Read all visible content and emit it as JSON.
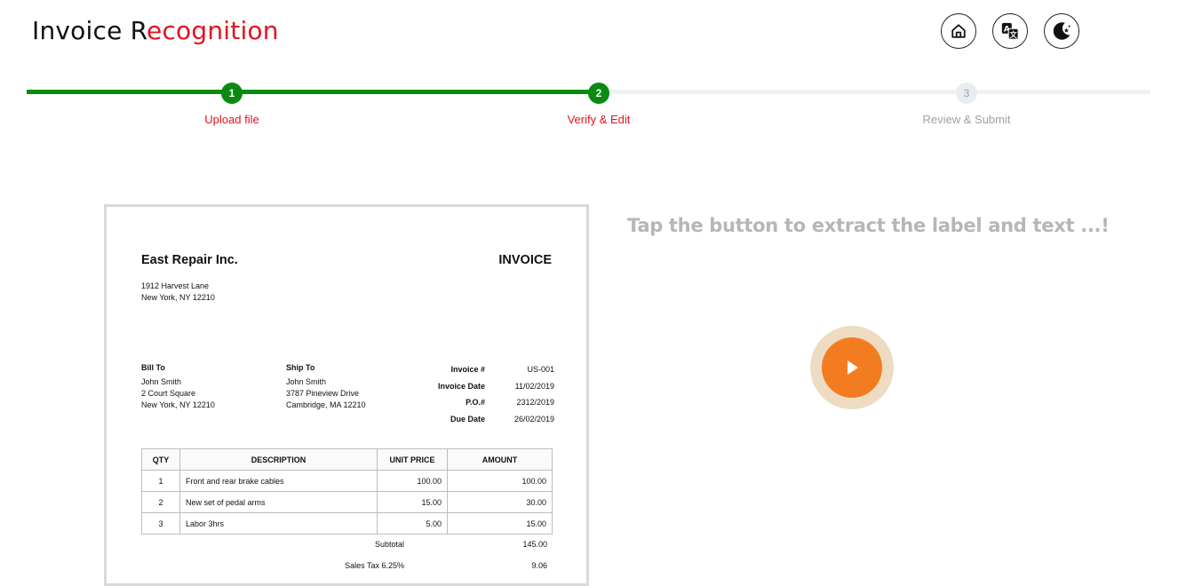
{
  "header": {
    "title_part1": "Invoice R",
    "title_part2": "ecognition",
    "icons": [
      "home-icon",
      "translate-icon",
      "dark-mode-icon"
    ]
  },
  "stepper": {
    "steps": [
      {
        "number": "1",
        "label": "Upload file",
        "state": "completed"
      },
      {
        "number": "2",
        "label": "Verify & Edit",
        "state": "active"
      },
      {
        "number": "3",
        "label": "Review & Submit",
        "state": "pending"
      }
    ],
    "colors": {
      "active": "#0b8a12",
      "label_active": "#e0141e",
      "inactive": "#9aa1a9"
    }
  },
  "invoice": {
    "company": "East Repair Inc.",
    "doc_title": "INVOICE",
    "address": [
      "1912 Harvest Lane",
      "New York, NY 12210"
    ],
    "bill_to": {
      "label": "Bill To",
      "lines": [
        "John Smith",
        "2 Court Square",
        "New York, NY 12210"
      ]
    },
    "ship_to": {
      "label": "Ship To",
      "lines": [
        "John Smith",
        "3787 Pineview Drive",
        "Cambridge, MA 12210"
      ]
    },
    "meta": [
      {
        "key": "Invoice #",
        "value": "US-001"
      },
      {
        "key": "Invoice Date",
        "value": "11/02/2019"
      },
      {
        "key": "P.O.#",
        "value": "2312/2019"
      },
      {
        "key": "Due Date",
        "value": "26/02/2019"
      }
    ],
    "table": {
      "headers": [
        "QTY",
        "DESCRIPTION",
        "UNIT PRICE",
        "AMOUNT"
      ],
      "rows": [
        [
          "1",
          "Front and rear brake cables",
          "100.00",
          "100.00"
        ],
        [
          "2",
          "New set of pedal arms",
          "15.00",
          "30.00"
        ],
        [
          "3",
          "Labor 3hrs",
          "5.00",
          "15.00"
        ]
      ]
    },
    "totals": [
      {
        "key": "Subtotal",
        "value": "145.00"
      },
      {
        "key": "Sales Tax 6.25%",
        "value": "9.06"
      }
    ]
  },
  "extract": {
    "prompt": "Tap the button to extract the label and text ...!",
    "button_color": "#f47c20"
  }
}
